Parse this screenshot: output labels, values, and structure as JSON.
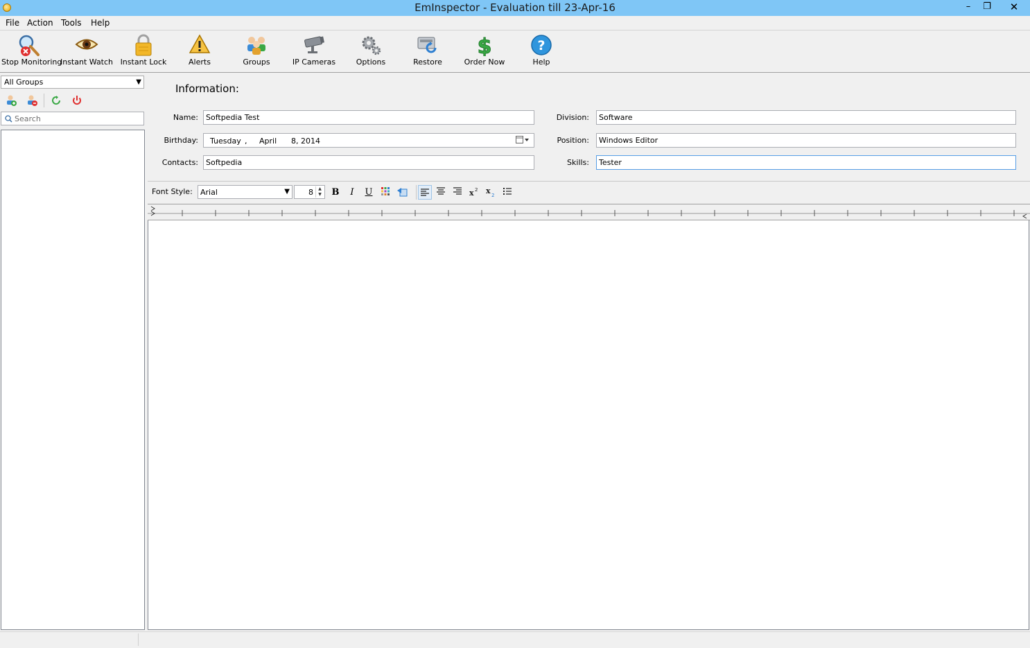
{
  "window": {
    "title": "EmInspector - Evaluation till 23-Apr-16",
    "minimize_glyph": "–",
    "maximize_glyph": "❐",
    "close_glyph": "✕"
  },
  "menu": [
    "File",
    "Action",
    "Tools",
    "Help"
  ],
  "toolbar": {
    "stop_monitoring": "Stop Monitoring",
    "instant_watch": "Instant Watch",
    "instant_lock": "Instant Lock",
    "alerts": "Alerts",
    "groups": "Groups",
    "ip_cameras": "IP Cameras",
    "options": "Options",
    "restore": "Restore",
    "order_now": "Order Now",
    "help": "Help"
  },
  "sidebar": {
    "group_select": "All Groups",
    "search_placeholder": "Search"
  },
  "info": {
    "title": "Information:",
    "name_label": "Name:",
    "name_value": "Softpedia Test",
    "birthday_label": "Birthday:",
    "birthday_day": "Tuesday",
    "birthday_comma": ",",
    "birthday_month": "April",
    "birthday_date": "8, 2014",
    "contacts_label": "Contacts:",
    "contacts_value": "Softpedia",
    "division_label": "Division:",
    "division_value": "Software",
    "position_label": "Position:",
    "position_value": "Windows Editor",
    "skills_label": "Skills:",
    "skills_value": "Tester"
  },
  "format": {
    "font_style_label": "Font Style:",
    "font_name": "Arial",
    "font_size": "8",
    "bold": "B",
    "italic": "I",
    "underline": "U"
  },
  "colors": {
    "titlebar": "#7fc6f6",
    "focus_border": "#569de5"
  }
}
